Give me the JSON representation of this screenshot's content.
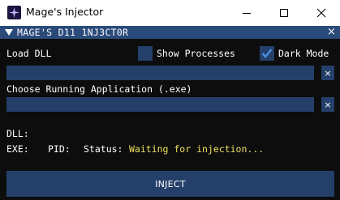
{
  "window": {
    "title": "Mage's Injector",
    "icon": "mage-app-icon",
    "controls": [
      "minimize-icon",
      "maximize-icon",
      "close-icon"
    ]
  },
  "panel": {
    "title": "MAGE'S D11 1NJ3CT0R",
    "close_label": "×"
  },
  "load_dll": {
    "label": "Load DLL",
    "value": "",
    "clear_label": "×"
  },
  "options": {
    "show_processes": {
      "label": "Show Processes",
      "checked": false
    },
    "dark_mode": {
      "label": "Dark Mode",
      "checked": true
    }
  },
  "choose_app": {
    "label": "Choose Running Application (.exe)",
    "value": "",
    "clear_label": "×"
  },
  "info": {
    "dll_label": "DLL:",
    "exe_label": "EXE:",
    "pid_label": "PID:",
    "status_label": "Status:",
    "status_value": "Waiting for injection..."
  },
  "inject_button": {
    "label": "INJECT"
  },
  "colors": {
    "header": "#2a4a7a",
    "widget": "#24406a",
    "background": "#0d0d0d",
    "status_text": "#f0e060",
    "check": "#4a90e0"
  }
}
